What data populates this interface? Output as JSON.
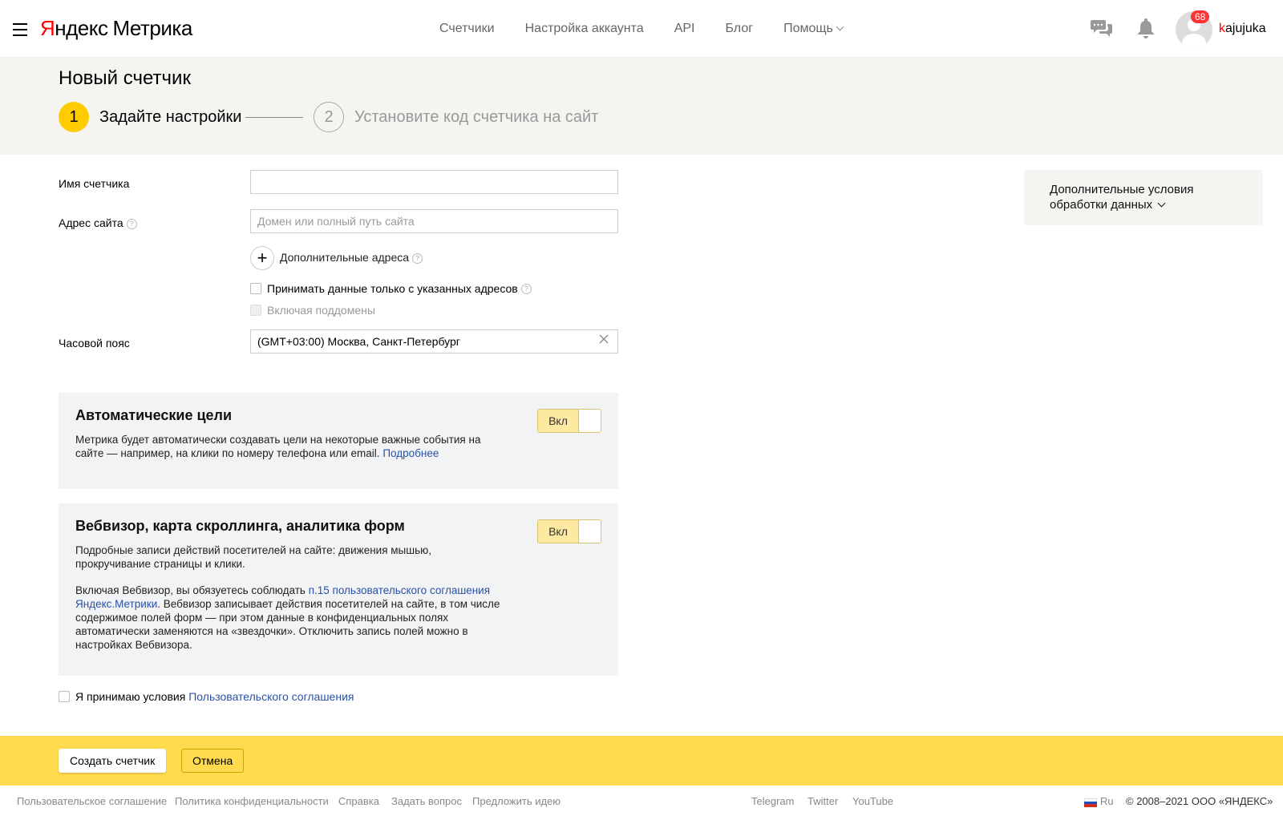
{
  "header": {
    "logo_ya": "Я",
    "logo_rest": "ндекс",
    "logo_product": "Метрика",
    "nav": [
      "Счетчики",
      "Настройка аккаунта",
      "API",
      "Блог",
      "Помощь"
    ],
    "notifications_count": "68",
    "username_first": "k",
    "username_rest": "ajujuka"
  },
  "page": {
    "title": "Новый счетчик",
    "step1_number": "1",
    "step1_label": "Задайте настройки",
    "step2_number": "2",
    "step2_label": "Установите код счетчика на сайт"
  },
  "form": {
    "counter_name_label": "Имя счетчика",
    "counter_name_value": "",
    "site_address_label": "Адрес сайта",
    "site_address_placeholder": "Домен или полный путь сайта",
    "extra_addresses_label": "Дополнительные адреса",
    "only_listed_label": "Принимать данные только с указанных адресов",
    "subdomains_label": "Включая поддомены",
    "timezone_label": "Часовой пояс",
    "timezone_value": "(GMT+03:00) Москва, Санкт-Петербург"
  },
  "auto_goals": {
    "title": "Автоматические цели",
    "text": "Метрика будет автоматически создавать цели на некоторые важные события на сайте — например, на клики по номеру телефона или email.",
    "link": "Подробнее",
    "toggle_label": "Вкл"
  },
  "webvisor": {
    "title": "Вебвизор, карта скроллинга, аналитика форм",
    "text1": "Подробные записи действий посетителей на сайте: движения мышью, прокручивание страницы и клики.",
    "text2_before": "Включая Вебвизор, вы обязуетесь соблюдать",
    "text2_link": "п.15 пользовательского соглашения Яндекс.Метрики",
    "text2_after": ". Вебвизор записывает действия посетителей на сайте, в том числе содержимое полей форм — при этом данные в конфиденциальных полях автоматически заменяются на «звездочки». Отключить запись полей можно в настройках Вебвизора.",
    "toggle_label": "Вкл"
  },
  "accept": {
    "text": "Я принимаю условия",
    "link": "Пользовательского соглашения"
  },
  "side_panel": {
    "text": "Дополнительные условия обработки данных"
  },
  "actions": {
    "create": "Создать счетчик",
    "cancel": "Отмена"
  },
  "footer": {
    "links": [
      "Пользовательское соглашение",
      "Политика конфиденциальности",
      "Справка",
      "Задать вопрос",
      "Предложить идею"
    ],
    "social": [
      "Telegram",
      "Twitter",
      "YouTube"
    ],
    "lang": "Ru",
    "copyright": "© 2008–2021 ООО «ЯНДЕКС»"
  },
  "colors": {
    "accent_yellow": "#ffdb4d",
    "step_active": "#ffcc00",
    "link": "#2a51a8",
    "badge": "#ff3333"
  }
}
